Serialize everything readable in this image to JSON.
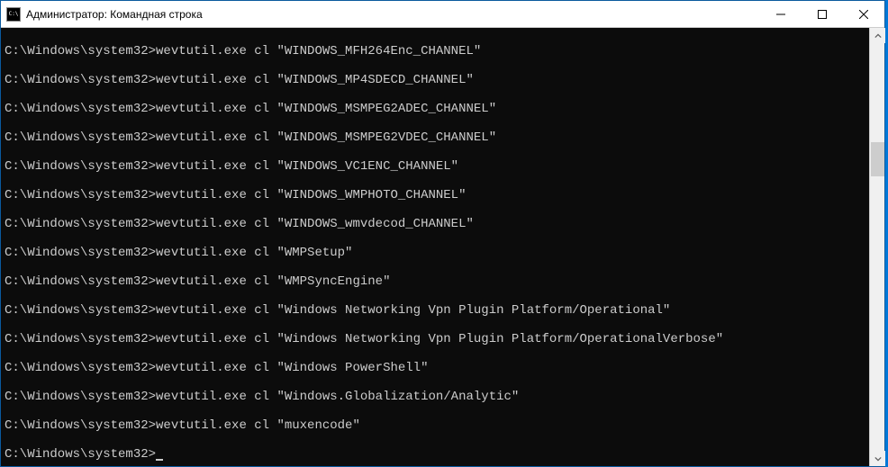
{
  "window": {
    "icon_text": "C:\\",
    "title": "Администратор: Командная строка"
  },
  "console": {
    "prompt": "C:\\Windows\\system32>",
    "command_prefix": "wevtutil.exe cl ",
    "entries": [
      "\"WINDOWS_MFH264Enc_CHANNEL\"",
      "\"WINDOWS_MP4SDECD_CHANNEL\"",
      "\"WINDOWS_MSMPEG2ADEC_CHANNEL\"",
      "\"WINDOWS_MSMPEG2VDEC_CHANNEL\"",
      "\"WINDOWS_VC1ENC_CHANNEL\"",
      "\"WINDOWS_WMPHOTO_CHANNEL\"",
      "\"WINDOWS_wmvdecod_CHANNEL\"",
      "\"WMPSetup\"",
      "\"WMPSyncEngine\"",
      "\"Windows Networking Vpn Plugin Platform/Operational\"",
      "\"Windows Networking Vpn Plugin Platform/OperationalVerbose\"",
      "\"Windows PowerShell\"",
      "\"Windows.Globalization/Analytic\"",
      "\"muxencode\""
    ]
  }
}
